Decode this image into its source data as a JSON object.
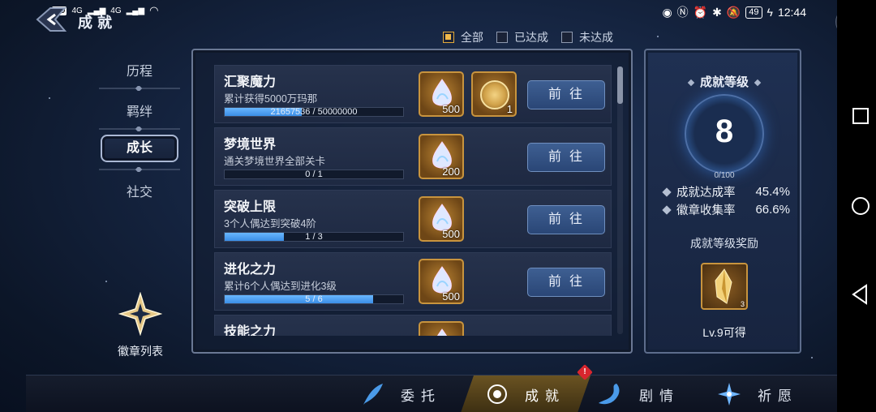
{
  "status_bar": {
    "left_icons": [
      "HD",
      "4G",
      "4G"
    ],
    "time": "12:44",
    "battery": "49"
  },
  "header": {
    "title": "成就"
  },
  "filters": [
    {
      "label": "全部",
      "checked": true
    },
    {
      "label": "已达成",
      "checked": false
    },
    {
      "label": "未达成",
      "checked": false
    }
  ],
  "sidebar": {
    "items": [
      {
        "label": "历程",
        "active": false
      },
      {
        "label": "羁绊",
        "active": false
      },
      {
        "label": "成长",
        "active": true
      },
      {
        "label": "社交",
        "active": false
      }
    ],
    "badge_list_label": "徽章列表"
  },
  "achievements": [
    {
      "name": "汇聚魔力",
      "desc": "累计获得5000万玛那",
      "progress_text": "21657536 / 50000000",
      "progress": 0.433,
      "rewards": [
        {
          "icon": "crystal-gem-icon",
          "count": "500"
        },
        {
          "icon": "gold-coin-icon",
          "count": "1"
        }
      ],
      "button": "前往"
    },
    {
      "name": "梦境世界",
      "desc": "通关梦境世界全部关卡",
      "progress_text": "0 / 1",
      "progress": 0,
      "rewards": [
        {
          "icon": "crystal-gem-icon",
          "count": "200"
        }
      ],
      "button": "前往"
    },
    {
      "name": "突破上限",
      "desc": "3个人偶达到突破4阶",
      "progress_text": "1 / 3",
      "progress": 0.333,
      "rewards": [
        {
          "icon": "crystal-gem-icon",
          "count": "500"
        }
      ],
      "button": "前往"
    },
    {
      "name": "进化之力",
      "desc": "累计6个人偶达到进化3级",
      "progress_text": "5 / 6",
      "progress": 0.833,
      "rewards": [
        {
          "icon": "crystal-gem-icon",
          "count": "500"
        }
      ],
      "button": "前往"
    },
    {
      "name": "技能之力",
      "desc": "",
      "progress_text": "",
      "progress": 0,
      "rewards": [
        {
          "icon": "crystal-gem-icon",
          "count": ""
        }
      ],
      "button": ""
    }
  ],
  "level_panel": {
    "title": "成就等级",
    "level": "8",
    "progress_text": "0/100",
    "stats": [
      {
        "label": "成就达成率",
        "value": "45.4%"
      },
      {
        "label": "徽章收集率",
        "value": "66.6%"
      }
    ],
    "reward_title": "成就等级奖励",
    "reward_count": "3",
    "reward_note": "Lv.9可得"
  },
  "bottom_tabs": [
    {
      "label": "委托",
      "icon": "feather-icon",
      "active": false
    },
    {
      "label": "成就",
      "icon": "medal-icon",
      "active": true
    },
    {
      "label": "剧情",
      "icon": "dragon-icon",
      "active": false
    },
    {
      "label": "祈愿",
      "icon": "star-burst-icon",
      "active": false
    }
  ],
  "colors": {
    "accent_gold": "#f0b84a",
    "button_blue": "#3e5f92",
    "progress_blue": "#69b7ff",
    "alert_red": "#d8262e"
  }
}
